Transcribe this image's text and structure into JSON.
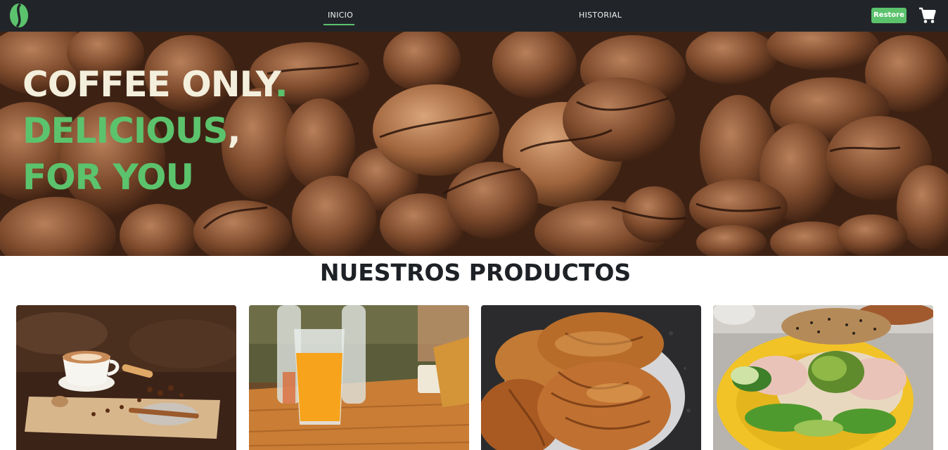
{
  "navbar": {
    "logo_icon": "coffee-bean-logo-icon",
    "links": [
      {
        "label": "INICIO",
        "active": true
      },
      {
        "label": "HISTORIAL",
        "active": false
      }
    ],
    "restore_label": "Restore",
    "cart_icon": "shopping-cart-icon"
  },
  "hero": {
    "line1": "COFFEE ONLY",
    "line1_punct": ".",
    "line2": "DELICIOUS",
    "line2_punct": ",",
    "line3": "FOR YOU"
  },
  "section": {
    "title": "NUESTROS PRODUCTOS"
  },
  "products": [
    {
      "image": "coffee-cup-image"
    },
    {
      "image": "orange-juice-image"
    },
    {
      "image": "croissants-image"
    },
    {
      "image": "sandwich-image"
    }
  ],
  "colors": {
    "navbar": "#212529",
    "accent_green": "#5cc36d",
    "hero_cream": "#f3efdc",
    "title_dark": "#1e2126"
  }
}
